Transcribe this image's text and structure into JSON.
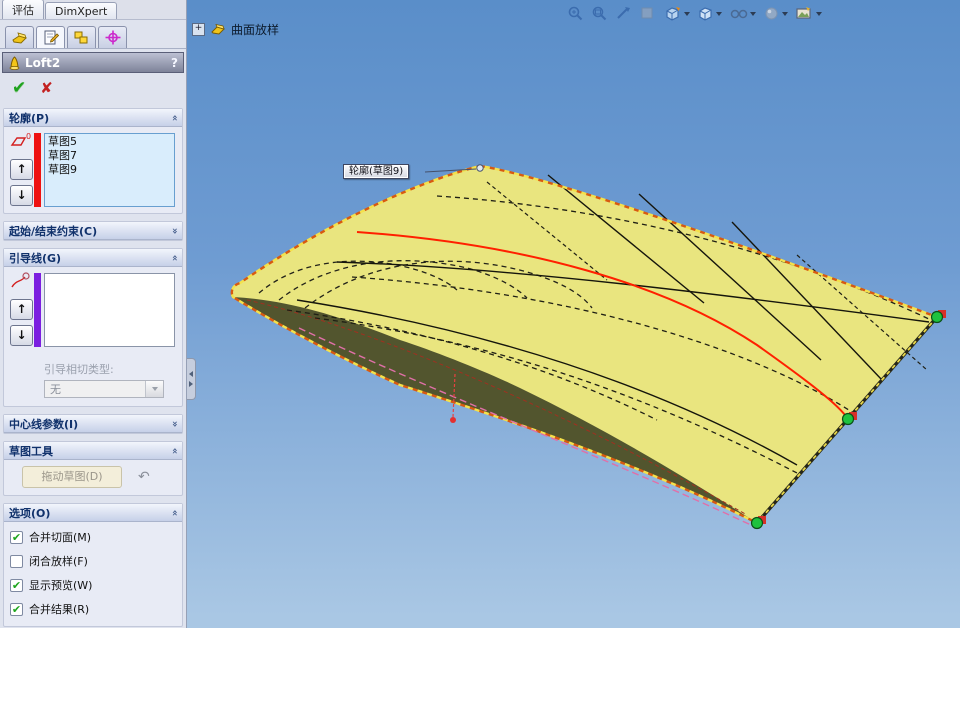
{
  "command_tabs": [
    {
      "label": "评估"
    },
    {
      "label": "DimXpert"
    }
  ],
  "icons": {
    "ok": "✔",
    "cancel": "✘",
    "help": "?",
    "up_arrow": "↑",
    "down_arrow": "↓",
    "undo": "↶",
    "check": "✔",
    "chevron_expanded": "«",
    "chevron_collapsed": "»",
    "expand_plus": "+"
  },
  "property_manager": {
    "title": "Loft2",
    "profiles": {
      "title": "轮廓(P)",
      "icon_badge": "0",
      "items": [
        {
          "name": "草图5"
        },
        {
          "name": "草图7"
        },
        {
          "name": "草图9"
        }
      ]
    },
    "constraints": {
      "title": "起始/结束约束(C)"
    },
    "guides": {
      "title": "引导线(G)",
      "tangency_label": "引导相切类型:",
      "tangency_value": "无"
    },
    "centerline": {
      "title": "中心线参数(I)"
    },
    "sketch_tools": {
      "title": "草图工具",
      "drag_label": "拖动草图(D)"
    },
    "options": {
      "title": "选项(O)",
      "items": [
        {
          "label": "合并切面(M)",
          "checked": true,
          "glyph": "✔"
        },
        {
          "label": "闭合放样(F)",
          "checked": false,
          "glyph": ""
        },
        {
          "label": "显示预览(W)",
          "checked": true,
          "glyph": "✔"
        },
        {
          "label": "合并结果(R)",
          "checked": true,
          "glyph": "✔"
        }
      ]
    }
  },
  "viewport": {
    "feature_label": "曲面放样",
    "callout": "轮廓(草图9)",
    "connector_count": 3,
    "colors": {
      "sky_top": "#5a8ec9",
      "sky_bottom": "#a9c7e4",
      "surface": "#e9e57f",
      "underside": "#52552e",
      "selected_edge_orange": "#d85a10",
      "selected_edge_yellow": "#f5e14a",
      "highlight_curve_red": "#ff2000",
      "connector_green": "#1ec23e",
      "guide_pink": "#e070a8"
    }
  },
  "heads_up_toolbar": {
    "icons": [
      "zoom-fit",
      "zoom-area",
      "previous-view",
      "section-view",
      "view-orientation",
      "display-style",
      "hide-show-items",
      "edit-appearance",
      "apply-scene"
    ]
  }
}
